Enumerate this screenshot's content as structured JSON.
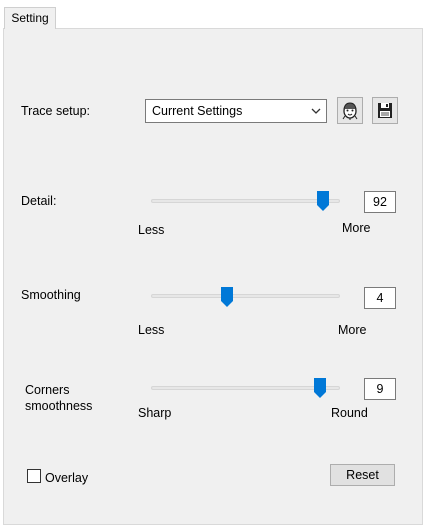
{
  "tabs": [
    {
      "label": "Setting"
    }
  ],
  "trace": {
    "label": "Trace setup:",
    "preset_value": "Current Settings",
    "reset_icon": "face-icon",
    "save_icon": "floppy-disk-icon"
  },
  "detail": {
    "label": "Detail:",
    "min_label": "Less",
    "max_label": "More",
    "value": "92",
    "level": 0.92
  },
  "smoothing": {
    "label": "Smoothing",
    "min_label": "Less",
    "max_label": "More",
    "value": "4",
    "level": 0.4
  },
  "corners": {
    "label_line1": "Corners",
    "label_line2": "smoothness",
    "min_label": "Sharp",
    "max_label": "Round",
    "value": "9",
    "level": 0.9
  },
  "overlay": {
    "label": "Overlay",
    "checked": false
  },
  "reset_button": {
    "label": "Reset"
  },
  "colors": {
    "accent": "#0078d7",
    "panel": "#f0f0f0"
  }
}
